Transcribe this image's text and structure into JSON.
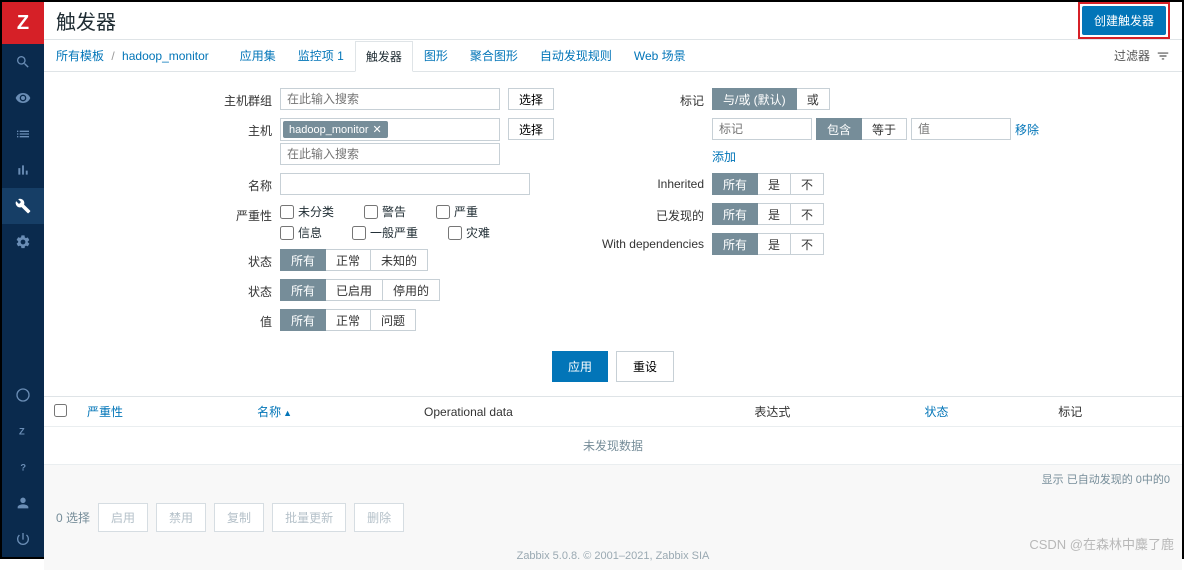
{
  "sidebar": {
    "logo": "Z"
  },
  "header": {
    "title": "触发器",
    "create_btn": "创建触发器"
  },
  "breadcrumb": {
    "all_templates": "所有模板",
    "template": "hadoop_monitor"
  },
  "tabs": {
    "apps": "应用集",
    "items": "监控项 1",
    "triggers": "触发器",
    "graphs": "图形",
    "screens": "聚合图形",
    "discovery": "自动发现规则",
    "web": "Web 场景"
  },
  "filter_toggle": "过滤器",
  "filter": {
    "hostgroup_label": "主机群组",
    "hostgroup_placeholder": "在此输入搜索",
    "select_btn": "选择",
    "host_label": "主机",
    "host_chip": "hadoop_monitor",
    "host_placeholder": "在此输入搜索",
    "name_label": "名称",
    "severity_label": "严重性",
    "sev": {
      "nc": "未分类",
      "warn": "警告",
      "avg": "严重",
      "info": "信息",
      "high": "一般严重",
      "disaster": "灾难"
    },
    "status_label": "状态",
    "status_all": "所有",
    "status_ok": "正常",
    "status_unknown": "未知的",
    "state_label": "状态",
    "state_all": "所有",
    "state_enabled": "已启用",
    "state_disabled": "停用的",
    "value_label": "值",
    "value_all": "所有",
    "value_ok": "正常",
    "value_problem": "问题",
    "tag_label": "标记",
    "tag_andor": "与/或 (默认)",
    "tag_or": "或",
    "tag_name_ph": "标记",
    "tag_contains": "包含",
    "tag_equals": "等于",
    "tag_value_ph": "值",
    "tag_remove": "移除",
    "tag_add": "添加",
    "inherited_label": "Inherited",
    "discovered_label": "已发现的",
    "deps_label": "With dependencies",
    "opt_all": "所有",
    "opt_yes": "是",
    "opt_no": "不"
  },
  "actions": {
    "apply": "应用",
    "reset": "重设"
  },
  "table": {
    "col_severity": "严重性",
    "col_name": "名称",
    "col_opdata": "Operational data",
    "col_expression": "表达式",
    "col_status": "状态",
    "col_tags": "标记",
    "nodata": "未发现数据",
    "summary": "显示 已自动发现的 0中的0"
  },
  "bulk": {
    "selected": "0 选择",
    "enable": "启用",
    "disable": "禁用",
    "copy": "复制",
    "massupdate": "批量更新",
    "delete": "删除"
  },
  "footer": "Zabbix 5.0.8. © 2001–2021, Zabbix SIA",
  "watermark": "CSDN @在森林中麋了鹿"
}
